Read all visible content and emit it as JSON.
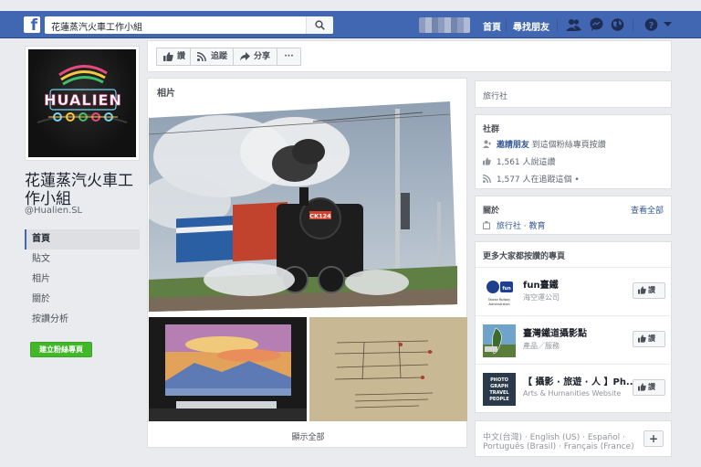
{
  "topbar": {
    "search_value": "花蓮蒸汽火車工作小組",
    "nav": [
      "首頁",
      "尋找朋友"
    ],
    "brand_color": "#4267b2"
  },
  "page": {
    "name": "花蓮蒸汽火車工作小組",
    "handle": "@Hualien.SL",
    "logo_text": "HUALIEN"
  },
  "left_nav": {
    "items": [
      "首頁",
      "貼文",
      "相片",
      "關於",
      "按讚分析"
    ],
    "active": "首頁"
  },
  "create_button": "建立粉絲專頁",
  "actions": {
    "like": "讚",
    "follow": "追蹤",
    "share": "分享",
    "more": "···"
  },
  "photos": {
    "title": "相片",
    "train_plate": "CK124",
    "see_all": "顯示全部"
  },
  "right": {
    "category": "旅行社",
    "community": {
      "title": "社群",
      "invite_link": "邀請朋友",
      "invite_text": "到這個粉絲專頁按讚",
      "likes": "1,561 人說這讚",
      "follows": "1,577 人在追蹤這個 •"
    },
    "about": {
      "title": "關於",
      "see_all": "查看全部",
      "categories": "旅行社 · 教育"
    },
    "liked_pages": {
      "title": "更多大家都按讚的專頁",
      "like_label": "讚",
      "items": [
        {
          "name": "fun臺鐵",
          "category": "海空運公司",
          "thumb_text": "Taiwan Railway Administration"
        },
        {
          "name": "臺灣鐵道攝影點",
          "category": "產品／服務",
          "thumb_text": ""
        },
        {
          "name": "【 攝影 · 旅遊 · 人 】Ph...",
          "category": "Arts & Humanities Website",
          "thumb_text": "PHOTO GRAPH TRAVEL PEOPLE"
        }
      ]
    },
    "languages": {
      "line1": "中文(台灣) · English (US) · Español ·",
      "line2": "Português (Brasil) · Français (France)",
      "plus": "+"
    }
  }
}
